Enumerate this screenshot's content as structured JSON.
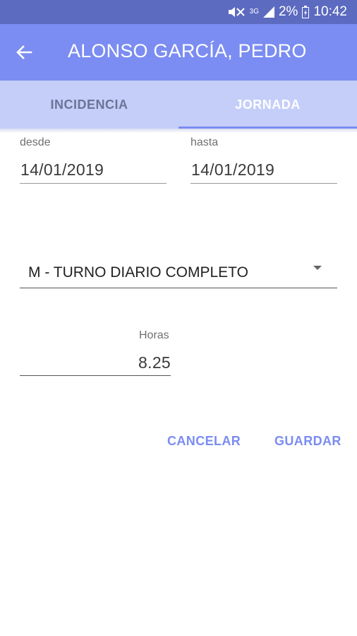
{
  "status_bar": {
    "network": "3G",
    "battery": "2%",
    "time": "10:42"
  },
  "header": {
    "back_icon": "arrow-left-icon",
    "title": "ALONSO GARCÍA, PEDRO"
  },
  "tabs": [
    {
      "label": "INCIDENCIA",
      "selected": false
    },
    {
      "label": "JORNADA",
      "selected": true
    }
  ],
  "form": {
    "desde": {
      "label": "desde",
      "value": "14/01/2019"
    },
    "hasta": {
      "label": "hasta",
      "value": "14/01/2019"
    },
    "turno": {
      "value": "M - TURNO DIARIO COMPLETO"
    },
    "horas": {
      "label": "Horas",
      "value": "8.25"
    }
  },
  "actions": {
    "cancel": "CANCELAR",
    "save": "GUARDAR"
  },
  "colors": {
    "status_bar": "#5c6bc0",
    "app_bar": "#7b8cf2",
    "tab_bar": "#c5cef9",
    "accent": "#7b8cf2"
  }
}
